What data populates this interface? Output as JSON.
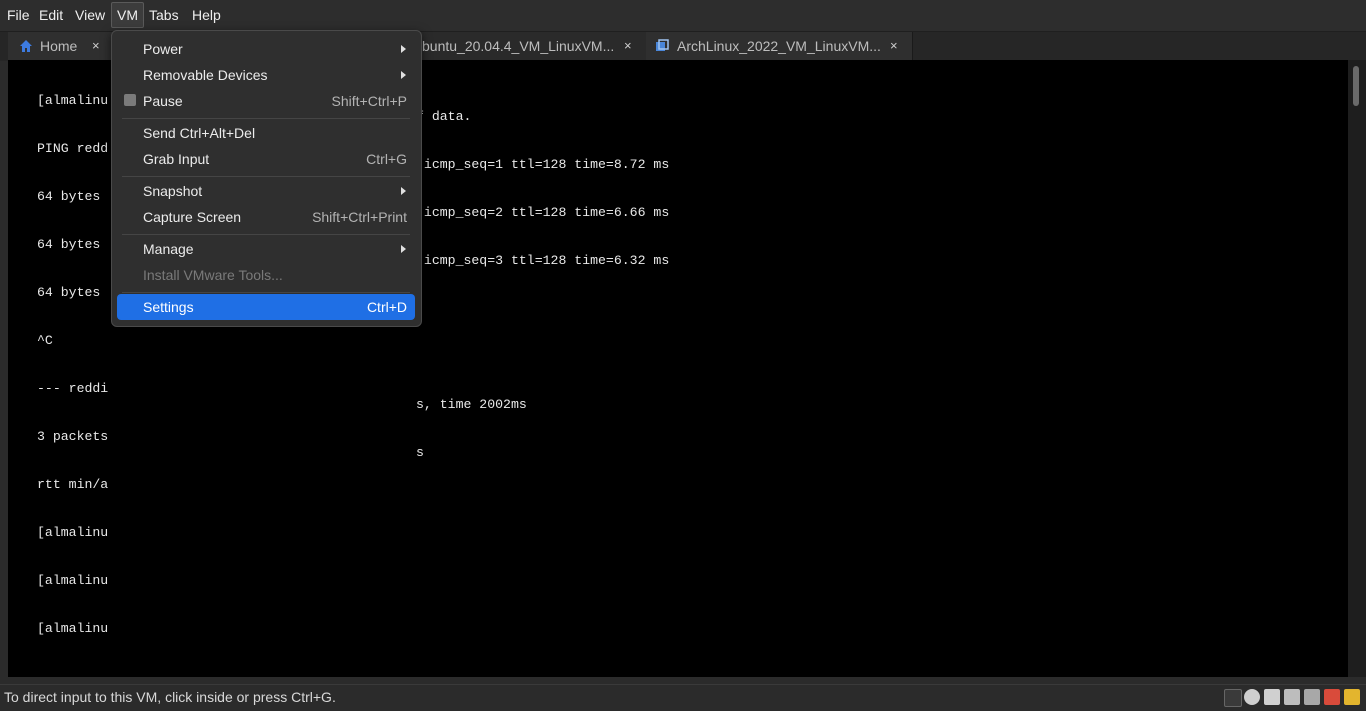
{
  "menubar": {
    "items": [
      {
        "label": "File"
      },
      {
        "label": "Edit"
      },
      {
        "label": "View"
      },
      {
        "label": "VM"
      },
      {
        "label": "Tabs"
      },
      {
        "label": "Help"
      }
    ]
  },
  "tabs": [
    {
      "label": "Home",
      "icon": "home-icon"
    },
    {
      "label": "buntu_20.04.4_VM_LinuxVM..."
    },
    {
      "label": "ArchLinux_2022_VM_LinuxVM...",
      "icon": "vm-icon"
    }
  ],
  "tab_close": "×",
  "terminal": {
    "left_lines": [
      "[almalinu",
      "PING redd",
      "64 bytes",
      "64 bytes",
      "64 bytes",
      "^C",
      "--- reddi",
      "3 packets",
      "rtt min/a",
      "[almalinu",
      "[almalinu",
      "[almalinu"
    ],
    "right_lines": [
      "f data.",
      " icmp_seq=1 ttl=128 time=8.72 ms",
      " icmp_seq=2 ttl=128 time=6.66 ms",
      " icmp_seq=3 ttl=128 time=6.32 ms",
      "",
      "",
      "s, time 2002ms",
      "s"
    ]
  },
  "vm_menu": {
    "power": "Power",
    "removable": "Removable Devices",
    "pause": "Pause",
    "pause_shortcut": "Shift+Ctrl+P",
    "send_cad": "Send Ctrl+Alt+Del",
    "grab": "Grab Input",
    "grab_shortcut": "Ctrl+G",
    "snapshot": "Snapshot",
    "capture": "Capture Screen",
    "capture_shortcut": "Shift+Ctrl+Print",
    "manage": "Manage",
    "install_tools": "Install VMware Tools...",
    "settings": "Settings",
    "settings_shortcut": "Ctrl+D"
  },
  "status": {
    "text": "To direct input to this VM, click inside or press Ctrl+G."
  },
  "colors": {
    "highlight": "#1f6fe5",
    "menu_bg": "#2f2f2f",
    "vm_bg": "#000000"
  }
}
